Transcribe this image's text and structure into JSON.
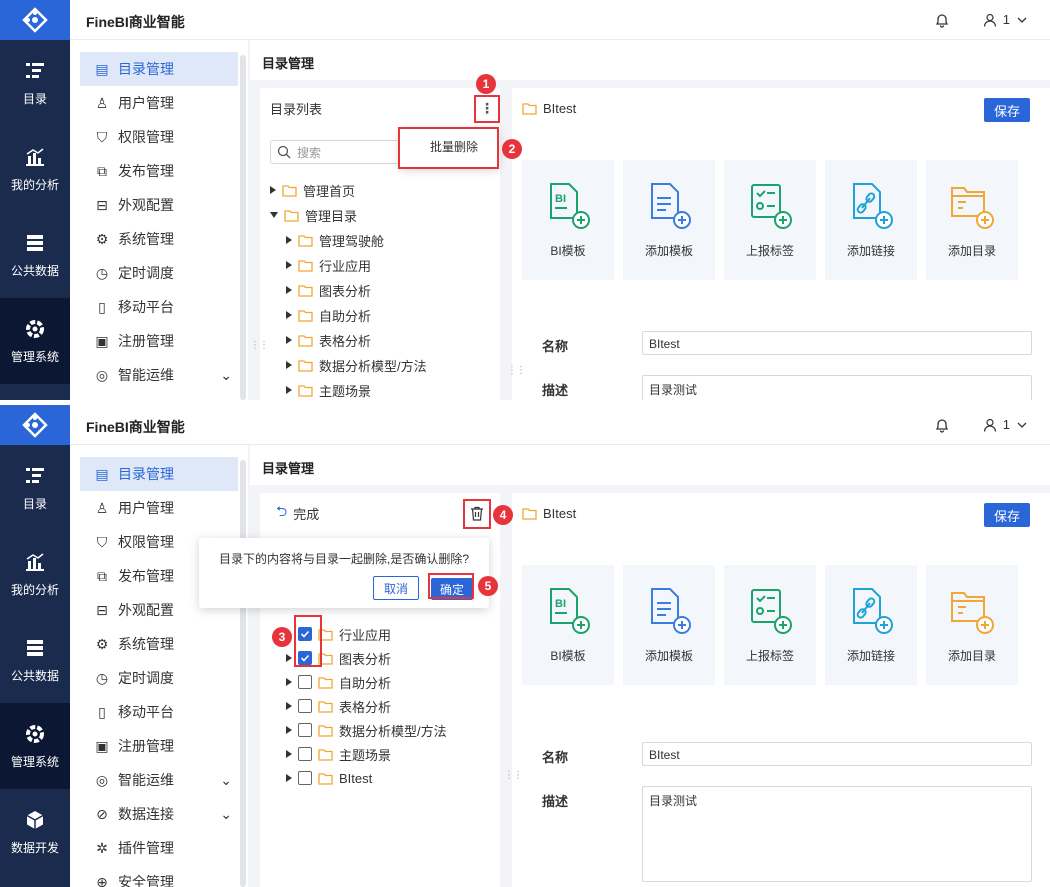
{
  "app": {
    "title": "FineBI商业智能",
    "user": "1"
  },
  "left_nav": {
    "items": [
      {
        "label": "目录",
        "icon": "catalog-icon"
      },
      {
        "label": "我的分析",
        "icon": "chart-icon"
      },
      {
        "label": "公共数据",
        "icon": "database-icon"
      },
      {
        "label": "管理系统",
        "icon": "gear-icon",
        "active": true
      },
      {
        "label": "数据开发",
        "icon": "cube-icon"
      }
    ]
  },
  "menu": {
    "items": [
      "目录管理",
      "用户管理",
      "权限管理",
      "发布管理",
      "外观配置",
      "系统管理",
      "定时调度",
      "移动平台",
      "注册管理",
      "智能运维",
      "数据连接",
      "插件管理",
      "安全管理"
    ]
  },
  "breadcrumb": "目录管理",
  "shot1": {
    "panel_title": "目录列表",
    "search_placeholder": "搜索",
    "batch_delete": "批量删除",
    "tree": [
      {
        "label": "管理首页",
        "level": 0,
        "expanded": false
      },
      {
        "label": "管理目录",
        "level": 0,
        "expanded": true
      },
      {
        "label": "管理驾驶舱",
        "level": 1
      },
      {
        "label": "行业应用",
        "level": 1
      },
      {
        "label": "图表分析",
        "level": 1
      },
      {
        "label": "自助分析",
        "level": 1
      },
      {
        "label": "表格分析",
        "level": 1
      },
      {
        "label": "数据分析模型/方法",
        "level": 1
      },
      {
        "label": "主题场景",
        "level": 1
      }
    ],
    "badges": [
      "1",
      "2"
    ]
  },
  "shot2": {
    "done_label": "完成",
    "confirm_text": "目录下的内容将与目录一起删除,是否确认删除?",
    "cancel_label": "取消",
    "ok_label": "确定",
    "tree": [
      {
        "label": "行业应用",
        "checked": true
      },
      {
        "label": "图表分析",
        "checked": true
      },
      {
        "label": "自助分析",
        "checked": false
      },
      {
        "label": "表格分析",
        "checked": false
      },
      {
        "label": "数据分析模型/方法",
        "checked": false
      },
      {
        "label": "主题场景",
        "checked": false
      },
      {
        "label": "BItest",
        "checked": false
      }
    ],
    "badges": [
      "3",
      "4",
      "5"
    ]
  },
  "detail": {
    "folder_name": "BItest",
    "save_label": "保存",
    "cards": [
      {
        "label": "BI模板",
        "icon": "bi-template-icon",
        "color": "#1aa36b"
      },
      {
        "label": "添加模板",
        "icon": "add-template-icon",
        "color": "#3b7ddd"
      },
      {
        "label": "上报标签",
        "icon": "report-tag-icon",
        "color": "#1aa36b"
      },
      {
        "label": "添加链接",
        "icon": "add-link-icon",
        "color": "#1fa3d6"
      },
      {
        "label": "添加目录",
        "icon": "add-folder-icon",
        "color": "#f0a733"
      }
    ],
    "name_label": "名称",
    "name_value": "BItest",
    "desc_label": "描述",
    "desc_value": "目录测试"
  },
  "colors": {
    "accent": "#2a66d8",
    "nav_bg": "#1a2b4d",
    "annotation": "#e5353b",
    "folder": "#f0a733"
  }
}
